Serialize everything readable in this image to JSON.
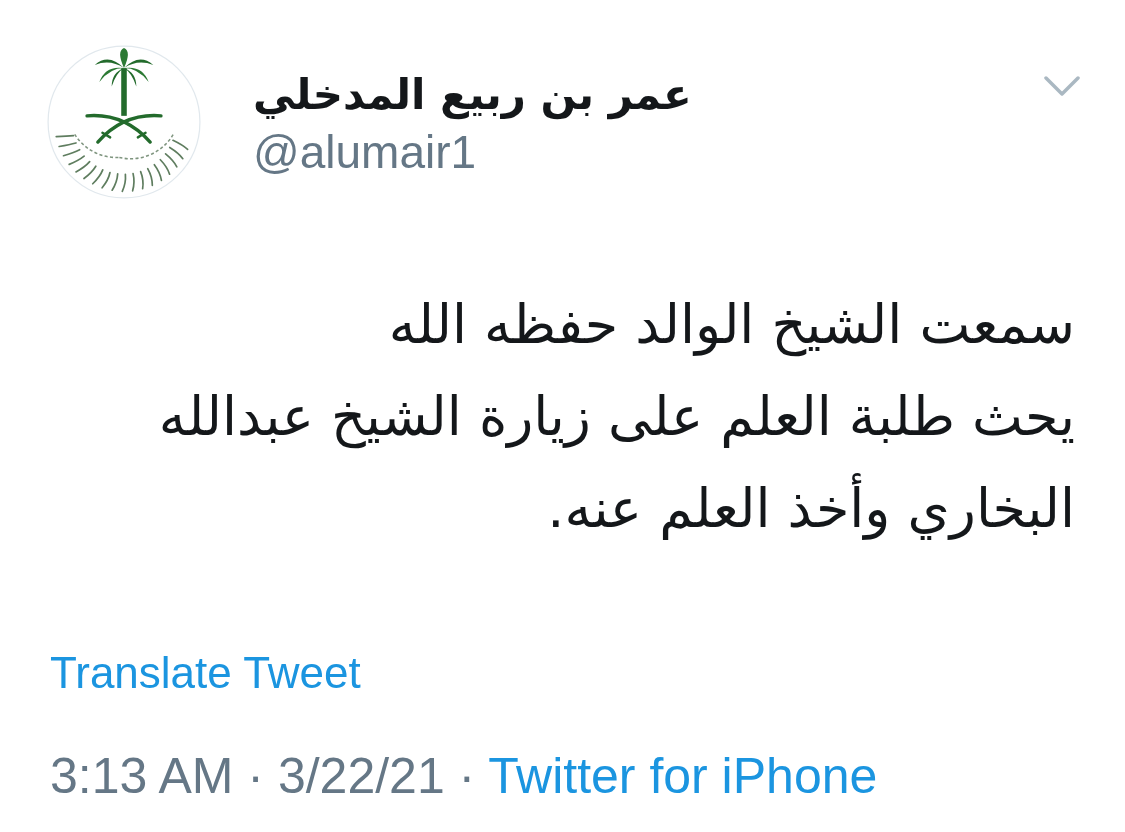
{
  "author": {
    "name": "عمر بن ربيع المدخلي",
    "handle": "@alumair1"
  },
  "tweet": {
    "text": "سمعت الشيخ الوالد حفظه الله\nيحث طلبة العلم على زيارة الشيخ عبدالله\nالبخاري وأخذ العلم عنه.",
    "translate_link": "Translate Tweet"
  },
  "meta": {
    "timestamp": "3:13 AM · 3/22/21 ·",
    "source": "Twitter for iPhone"
  }
}
